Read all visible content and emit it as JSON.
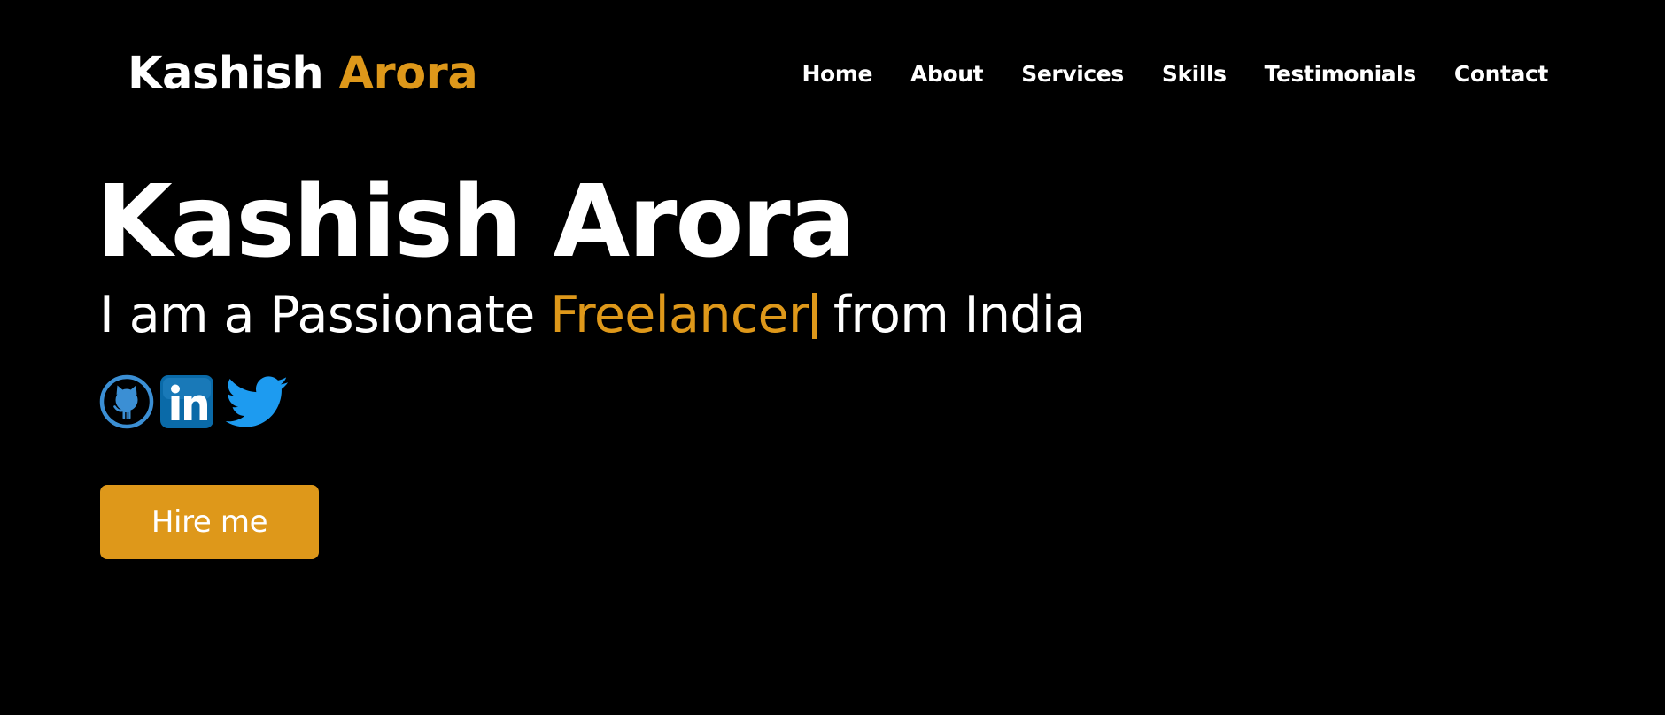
{
  "header": {
    "logo_first": "Kashish",
    "logo_accent": "Arora",
    "nav": [
      "Home",
      "About",
      "Services",
      "Skills",
      "Testimonials",
      "Contact"
    ]
  },
  "hero": {
    "title": "Kashish Arora",
    "subtitle_before": "I am a Passionate",
    "subtitle_typed": "Freelancer",
    "subtitle_after": "from India",
    "hire_button": "Hire me"
  },
  "socials": [
    {
      "name": "github",
      "icon": "github-icon",
      "color": "#3b8fd4"
    },
    {
      "name": "linkedin",
      "icon": "linkedin-icon",
      "color": "#0a6aa8"
    },
    {
      "name": "twitter",
      "icon": "twitter-icon",
      "color": "#1d9bf0"
    }
  ],
  "colors": {
    "background": "#000000",
    "text": "#ffffff",
    "accent": "#de981a"
  }
}
